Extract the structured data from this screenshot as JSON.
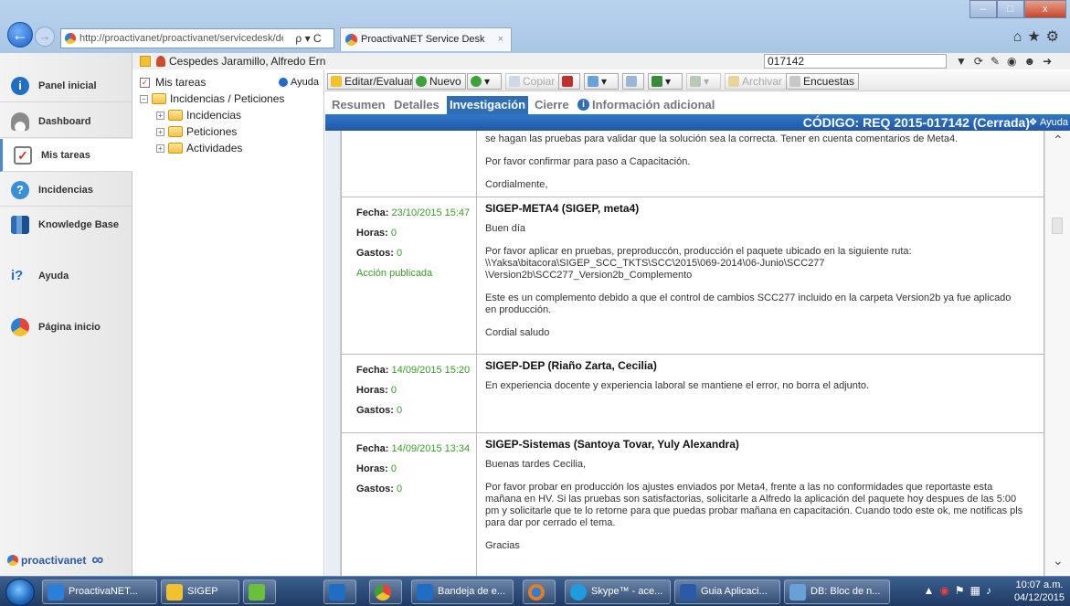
{
  "browser": {
    "address": "http://proactivanet/proactivanet/servicedesk/default.",
    "tab_title": "ProactivaNET Service Desk",
    "tab_close": "×",
    "window_controls": [
      "–",
      "□",
      "x"
    ],
    "address_controls": "ρ ▾ C"
  },
  "user": {
    "name": "Cespedes Jaramillo, Alfredo Ernesto"
  },
  "nav": {
    "items": [
      {
        "label": "Panel inicial",
        "icon": "info-icon",
        "color": "#1f6dc4"
      },
      {
        "label": "Dashboard",
        "icon": "gauge-icon",
        "color": "#7a7a7a"
      },
      {
        "label": "Mis tareas",
        "icon": "checklist-icon",
        "color": "#c03a2b"
      },
      {
        "label": "Incidencias",
        "icon": "question-icon",
        "color": "#3a8fd9"
      },
      {
        "label": "Knowledge Base",
        "icon": "books-icon",
        "color": "#2f6db5"
      },
      {
        "label": "Ayuda",
        "icon": "help-icon",
        "color": "#1f6dc4"
      },
      {
        "label": "Página inicio",
        "icon": "home-icon",
        "color": "#e87b1f"
      }
    ],
    "brand": "proactivanet"
  },
  "tree": {
    "root": "Mis tareas",
    "help": "Ayuda",
    "parent": "Incidencias / Peticiones",
    "children": [
      "Incidencias",
      "Peticiones",
      "Actividades"
    ]
  },
  "search": {
    "value": "017142"
  },
  "toolbar": {
    "edit": "Editar/Evaluar",
    "new": "Nuevo",
    "copy": "Copiar",
    "archive": "Archivar",
    "surveys": "Encuestas"
  },
  "tabs": [
    "Resumen",
    "Detalles",
    "Investigación",
    "Cierre",
    "Información adicional"
  ],
  "active_tab": "Investigación",
  "code_bar": {
    "title": "CÓDIGO: REQ 2015-017142 (Cerrada)",
    "help": "Ayuda"
  },
  "labels": {
    "date": "Fecha:",
    "hours": "Horas:",
    "costs": "Gastos:"
  },
  "entries": [
    {
      "date": "",
      "hours": "",
      "costs": "",
      "status": "",
      "author": "",
      "paragraphs": [
        "se hagan las pruebas para validar que la solución sea la correcta. Tener en cuenta comentarios de Meta4.",
        "Por favor confirmar para paso a Capacitación.",
        "Cordialmente,"
      ]
    },
    {
      "date": "23/10/2015 15:47",
      "hours": "0",
      "costs": "0",
      "status": "Acción publicada",
      "author": "SIGEP-META4 (SIGEP, meta4)",
      "paragraphs": [
        "Buen día",
        "Por favor aplicar en pruebas, preproduccón, producción el paquete ubicado en la siguiente ruta: \\\\Yaksa\\bitacora\\SIGEP_SCC_TKTS\\SCC\\2015\\069-2014\\06-Junio\\SCC277 \\Version2b\\SCC277_Version2b_Complemento",
        "Este es un complemento debido a que el control de cambios SCC277 incluido en la carpeta Version2b ya fue aplicado en producción.",
        "Cordial saludo"
      ]
    },
    {
      "date": "14/09/2015 15:20",
      "hours": "0",
      "costs": "0",
      "status": "",
      "author": "SIGEP-DEP (Riaño Zarta, Cecilia)",
      "paragraphs": [
        "En experiencia docente y experiencia laboral se mantiene el error, no borra el adjunto."
      ]
    },
    {
      "date": "14/09/2015 13:34",
      "hours": "0",
      "costs": "0",
      "status": "",
      "author": "SIGEP-Sistemas (Santoya Tovar, Yuly Alexandra)",
      "paragraphs": [
        "Buenas tardes Cecilia,",
        "Por favor probar en producción los ajustes enviados por Meta4, frente a las no conformidades que reportaste esta mañana en HV. Si las pruebas son satisfactorias, solicitarle a Alfredo la aplicación del paquete hoy despues de las 5:00 pm y solicitarle que te lo retorne para que puedas probar mañana en capacitación. Cuando todo este ok, me notificas pls para dar por cerrado el tema.",
        "Gracias"
      ]
    }
  ],
  "taskbar": {
    "items": [
      {
        "label": "ProactivaNET...",
        "color": "#2c7fd6"
      },
      {
        "label": "SIGEP",
        "color": "#f2c12e"
      },
      {
        "label": "",
        "color": "#6bbf3a"
      },
      {
        "label": "",
        "color": "#1f6dc4"
      },
      {
        "label": "",
        "color": "#e9423a"
      },
      {
        "label": "Bandeja de e...",
        "color": "#1f6dc4"
      },
      {
        "label": "",
        "color": "#e87b1f"
      },
      {
        "label": "Skype™ - ace...",
        "color": "#1f9be0"
      },
      {
        "label": "Guia Aplicaci...",
        "color": "#2b5aa8"
      },
      {
        "label": "DB: Bloc de n...",
        "color": "#6aa0d8"
      }
    ],
    "time": "10:07 a.m.",
    "date": "04/12/2015"
  }
}
